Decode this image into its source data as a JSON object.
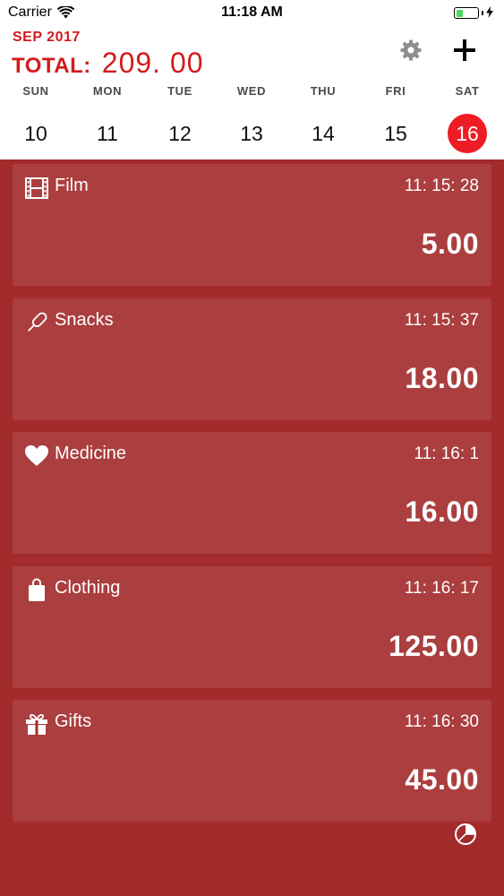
{
  "status_bar": {
    "carrier": "Carrier",
    "time": "11:18 AM",
    "wifi_icon": "wifi-icon",
    "battery_level": 0.4,
    "charging_icon": "bolt-icon"
  },
  "header": {
    "month": "SEP 2017",
    "total_label": "TOTAL:",
    "total_value": "209. 00",
    "settings_icon": "gear-icon",
    "add_icon": "plus-icon"
  },
  "week": {
    "days": [
      {
        "name": "SUN",
        "number": "10"
      },
      {
        "name": "MON",
        "number": "11"
      },
      {
        "name": "TUE",
        "number": "12"
      },
      {
        "name": "WED",
        "number": "13"
      },
      {
        "name": "THU",
        "number": "14"
      },
      {
        "name": "FRI",
        "number": "15"
      },
      {
        "name": "SAT",
        "number": "16"
      }
    ],
    "selected_index": 6
  },
  "expenses": [
    {
      "category": "Film",
      "icon": "film-icon",
      "time": "11: 15: 28",
      "amount": "5.00"
    },
    {
      "category": "Snacks",
      "icon": "popsicle-icon",
      "time": "11: 15: 37",
      "amount": "18.00"
    },
    {
      "category": "Medicine",
      "icon": "heart-icon",
      "time": "11: 16: 1",
      "amount": "16.00"
    },
    {
      "category": "Clothing",
      "icon": "shopping-bag-icon",
      "time": "11: 16: 17",
      "amount": "125.00"
    },
    {
      "category": "Gifts",
      "icon": "gift-icon",
      "time": "11: 16: 30",
      "amount": "45.00"
    }
  ],
  "footer": {
    "chart_icon": "pie-chart-icon"
  },
  "colors": {
    "accent_red": "#d41b1b",
    "selected_day": "#ee1c25",
    "list_background": "#a32b2b"
  }
}
